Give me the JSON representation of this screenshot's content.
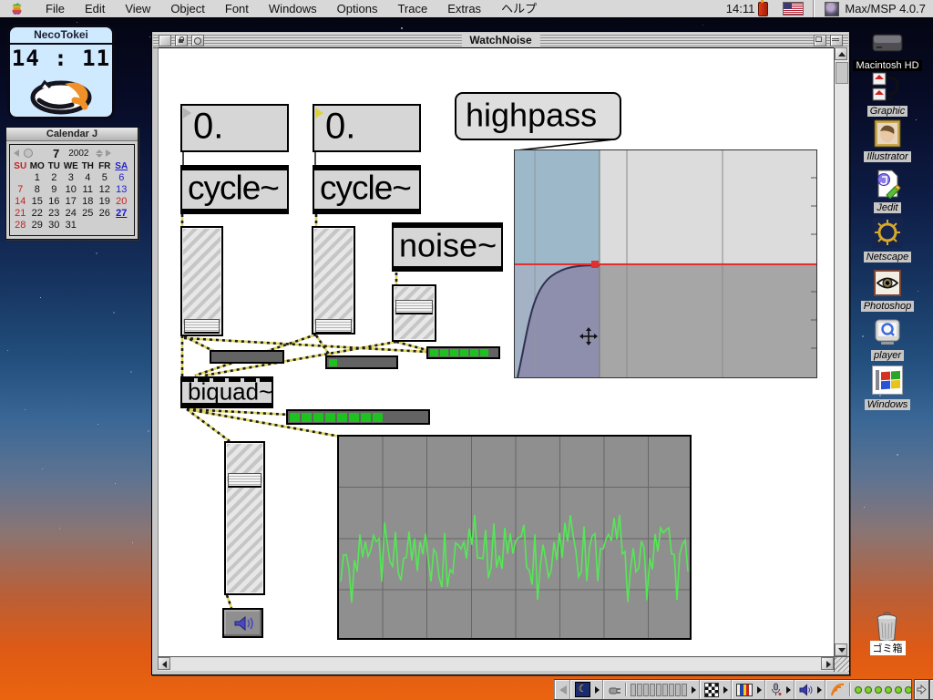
{
  "menu_bar": {
    "apple_icon": "apple-logo-icon",
    "items": [
      {
        "id": "file",
        "label": "File"
      },
      {
        "id": "edit",
        "label": "Edit"
      },
      {
        "id": "view",
        "label": "View"
      },
      {
        "id": "object",
        "label": "Object"
      },
      {
        "id": "font",
        "label": "Font"
      },
      {
        "id": "windows",
        "label": "Windows"
      },
      {
        "id": "options",
        "label": "Options"
      },
      {
        "id": "trace",
        "label": "Trace"
      },
      {
        "id": "extras",
        "label": "Extras"
      },
      {
        "id": "help",
        "label": "ヘルプ"
      }
    ],
    "clock": "14:11",
    "app_name": "Max/MSP 4.0.7"
  },
  "neco_tokei": {
    "title": "NecoTokei",
    "time": "14 : 11"
  },
  "calendar": {
    "title": "Calendar J",
    "month": "7",
    "year": "2002",
    "day_headers": [
      {
        "label": "SU",
        "s": "red"
      },
      {
        "label": "MO",
        "s": ""
      },
      {
        "label": "TU",
        "s": ""
      },
      {
        "label": "WE",
        "s": ""
      },
      {
        "label": "TH",
        "s": ""
      },
      {
        "label": "FR",
        "s": ""
      },
      {
        "label": "SA",
        "s": "blue"
      }
    ],
    "weeks": [
      [
        {
          "d": "",
          "s": ""
        },
        {
          "d": "1",
          "s": ""
        },
        {
          "d": "2",
          "s": ""
        },
        {
          "d": "3",
          "s": ""
        },
        {
          "d": "4",
          "s": ""
        },
        {
          "d": "5",
          "s": ""
        },
        {
          "d": "6",
          "s": "blue"
        }
      ],
      [
        {
          "d": "7",
          "s": "red"
        },
        {
          "d": "8",
          "s": ""
        },
        {
          "d": "9",
          "s": ""
        },
        {
          "d": "10",
          "s": ""
        },
        {
          "d": "11",
          "s": ""
        },
        {
          "d": "12",
          "s": ""
        },
        {
          "d": "13",
          "s": "blue"
        }
      ],
      [
        {
          "d": "14",
          "s": "red"
        },
        {
          "d": "15",
          "s": ""
        },
        {
          "d": "16",
          "s": ""
        },
        {
          "d": "17",
          "s": ""
        },
        {
          "d": "18",
          "s": ""
        },
        {
          "d": "19",
          "s": ""
        },
        {
          "d": "20",
          "s": "red"
        }
      ],
      [
        {
          "d": "21",
          "s": "red"
        },
        {
          "d": "22",
          "s": ""
        },
        {
          "d": "23",
          "s": ""
        },
        {
          "d": "24",
          "s": ""
        },
        {
          "d": "25",
          "s": ""
        },
        {
          "d": "26",
          "s": ""
        },
        {
          "d": "27",
          "s": "today"
        }
      ],
      [
        {
          "d": "28",
          "s": "red"
        },
        {
          "d": "29",
          "s": ""
        },
        {
          "d": "30",
          "s": ""
        },
        {
          "d": "31",
          "s": ""
        },
        {
          "d": "",
          "s": ""
        },
        {
          "d": "",
          "s": ""
        },
        {
          "d": "",
          "s": ""
        }
      ]
    ]
  },
  "window": {
    "title": "WatchNoise"
  },
  "patch": {
    "number_box_1": "0.",
    "number_box_2": "0.",
    "cycle_1": "cycle~",
    "cycle_2": "cycle~",
    "noise": "noise~",
    "biquad": "biquad~",
    "message": "highpass",
    "meters": [
      0,
      1,
      6,
      8
    ]
  },
  "desktop_icons": [
    {
      "id": "macintosh-hd",
      "label": "Macintosh HD",
      "icon": "hard-disk-icon",
      "style": "hd"
    },
    {
      "id": "graphic",
      "label": "Graphic",
      "icon": "graphic-folders-icon",
      "style": "alias"
    },
    {
      "id": "illustrator",
      "label": "Illustrator",
      "icon": "illustrator-portrait-icon",
      "style": "alias"
    },
    {
      "id": "jedit",
      "label": "Jedit",
      "icon": "jedit-document-icon",
      "style": "alias"
    },
    {
      "id": "netscape",
      "label": "Netscape",
      "icon": "netscape-wheel-icon",
      "style": "alias"
    },
    {
      "id": "photoshop",
      "label": "Photoshop",
      "icon": "photoshop-eye-icon",
      "style": "alias"
    },
    {
      "id": "player",
      "label": "player",
      "icon": "quicktime-player-icon",
      "style": "alias"
    },
    {
      "id": "windows",
      "label": "Windows",
      "icon": "windows-logo-icon",
      "style": "alias"
    },
    {
      "id": "trash",
      "label": "ゴミ箱",
      "icon": "trash-icon",
      "style": "trash"
    }
  ],
  "colors": {
    "cord_yellow": "#ded45c",
    "meter_green": "#1ec21e",
    "scope_green": "#55e855",
    "filter_red_line": "#e03030",
    "filter_band_blue": "#9db9c9",
    "filter_fill_purple": "#8e8fad",
    "menu_bg": "#d8d8d8",
    "desktop_top": "#04040f",
    "desktop_bottom": "#ea6410"
  }
}
